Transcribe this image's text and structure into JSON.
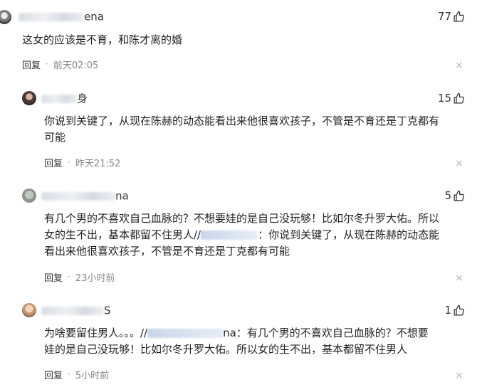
{
  "comments": [
    {
      "name_frag": "ena",
      "likes": "77",
      "lines": [
        "这女的应该是不育，和陈才离的婚"
      ],
      "reply_label": "回复",
      "time": "前天02:05",
      "close": "×"
    },
    {
      "name_frag": "身",
      "likes": "15",
      "lines": [
        "你说到关键了，从现在陈赫的动态能看出来他很喜欢孩子，不管是不育还是丁克都有",
        "可能"
      ],
      "reply_label": "回复",
      "time": "昨天21:52",
      "close": "×"
    },
    {
      "name_frag": "na",
      "likes": "5",
      "lines": [
        "有几个男的不喜欢自己血脉的？不想要娃的是自己没玩够！比如尔冬升罗大佑。所以",
        "女的生不出，基本都留不住男人//",
        "：你说到关键了，从现在陈赫的动态能",
        "看出来他很喜欢孩子，不管是不育还是丁克都有可能"
      ],
      "reply_label": "回复",
      "time": "23小时前",
      "close": "×"
    },
    {
      "name_frag": "S",
      "likes": "1",
      "lines": [
        "为啥要留住男人。。。//",
        "na：有几个男的不喜欢自己血脉的？不想要",
        "娃的是自己没玩够！比如尔冬升罗大佑。所以女的生不出，基本都留不住男人"
      ],
      "reply_label": "回复",
      "time": "5小时前",
      "close": "×"
    }
  ]
}
